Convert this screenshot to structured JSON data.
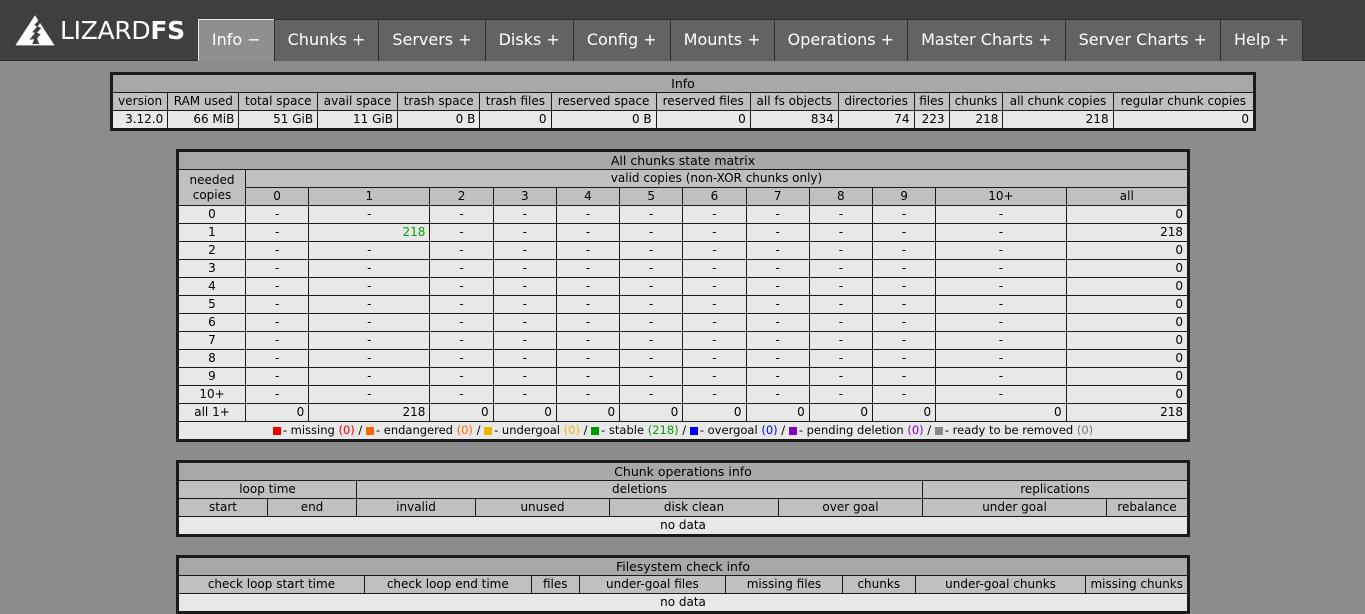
{
  "brand": {
    "name_light": "LIZARD",
    "name_bold": "FS",
    "logo_icon": "lizard-triangle-logo"
  },
  "nav": {
    "tabs": [
      {
        "label": "Info −",
        "active": true
      },
      {
        "label": "Chunks +",
        "active": false
      },
      {
        "label": "Servers +",
        "active": false
      },
      {
        "label": "Disks +",
        "active": false
      },
      {
        "label": "Config +",
        "active": false
      },
      {
        "label": "Mounts +",
        "active": false
      },
      {
        "label": "Operations +",
        "active": false
      },
      {
        "label": "Master Charts +",
        "active": false
      },
      {
        "label": "Server Charts +",
        "active": false
      },
      {
        "label": "Help +",
        "active": false
      }
    ]
  },
  "info_table": {
    "title": "Info",
    "headers": [
      "version",
      "RAM used",
      "total space",
      "avail space",
      "trash space",
      "trash files",
      "reserved space",
      "reserved files",
      "all fs objects",
      "directories",
      "files",
      "chunks",
      "all chunk copies",
      "regular chunk copies"
    ],
    "row": [
      "3.12.0",
      "66 MiB",
      "51 GiB",
      "11 GiB",
      "0 B",
      "0",
      "0 B",
      "0",
      "834",
      "74",
      "223",
      "218",
      "218",
      "0"
    ]
  },
  "matrix": {
    "title": "All chunks state matrix",
    "row_header_line1": "needed",
    "row_header_line2": "copies",
    "col_group_title": "valid copies (non-XOR chunks only)",
    "columns": [
      "0",
      "1",
      "2",
      "3",
      "4",
      "5",
      "6",
      "7",
      "8",
      "9",
      "10+",
      "all"
    ],
    "rows": [
      {
        "label": "0",
        "cells": [
          "-",
          "-",
          "-",
          "-",
          "-",
          "-",
          "-",
          "-",
          "-",
          "-",
          "-"
        ],
        "all": "0"
      },
      {
        "label": "1",
        "cells": [
          "-",
          "218",
          "-",
          "-",
          "-",
          "-",
          "-",
          "-",
          "-",
          "-",
          "-"
        ],
        "all": "218",
        "highlight_index": 1,
        "highlight_color": "green"
      },
      {
        "label": "2",
        "cells": [
          "-",
          "-",
          "-",
          "-",
          "-",
          "-",
          "-",
          "-",
          "-",
          "-",
          "-"
        ],
        "all": "0"
      },
      {
        "label": "3",
        "cells": [
          "-",
          "-",
          "-",
          "-",
          "-",
          "-",
          "-",
          "-",
          "-",
          "-",
          "-"
        ],
        "all": "0"
      },
      {
        "label": "4",
        "cells": [
          "-",
          "-",
          "-",
          "-",
          "-",
          "-",
          "-",
          "-",
          "-",
          "-",
          "-"
        ],
        "all": "0"
      },
      {
        "label": "5",
        "cells": [
          "-",
          "-",
          "-",
          "-",
          "-",
          "-",
          "-",
          "-",
          "-",
          "-",
          "-"
        ],
        "all": "0"
      },
      {
        "label": "6",
        "cells": [
          "-",
          "-",
          "-",
          "-",
          "-",
          "-",
          "-",
          "-",
          "-",
          "-",
          "-"
        ],
        "all": "0"
      },
      {
        "label": "7",
        "cells": [
          "-",
          "-",
          "-",
          "-",
          "-",
          "-",
          "-",
          "-",
          "-",
          "-",
          "-"
        ],
        "all": "0"
      },
      {
        "label": "8",
        "cells": [
          "-",
          "-",
          "-",
          "-",
          "-",
          "-",
          "-",
          "-",
          "-",
          "-",
          "-"
        ],
        "all": "0"
      },
      {
        "label": "9",
        "cells": [
          "-",
          "-",
          "-",
          "-",
          "-",
          "-",
          "-",
          "-",
          "-",
          "-",
          "-"
        ],
        "all": "0"
      },
      {
        "label": "10+",
        "cells": [
          "-",
          "-",
          "-",
          "-",
          "-",
          "-",
          "-",
          "-",
          "-",
          "-",
          "-"
        ],
        "all": "0"
      },
      {
        "label": "all 1+",
        "cells": [
          "0",
          "218",
          "0",
          "0",
          "0",
          "0",
          "0",
          "0",
          "0",
          "0",
          "0"
        ],
        "all": "218"
      }
    ],
    "legend": [
      {
        "color": "#ee0000",
        "label": "missing",
        "count": "0",
        "count_class": "num-red"
      },
      {
        "color": "#ff6600",
        "label": "endangered",
        "count": "0",
        "count_class": "num-orange-d"
      },
      {
        "color": "#f0b400",
        "label": "undergoal",
        "count": "0",
        "count_class": "num-orange-l"
      },
      {
        "color": "#009900",
        "label": "stable",
        "count": "218",
        "count_class": "num-green"
      },
      {
        "color": "#0000ee",
        "label": "overgoal",
        "count": "0",
        "count_class": "num-blue"
      },
      {
        "color": "#8800bb",
        "label": "pending deletion",
        "count": "0",
        "count_class": "num-purple"
      },
      {
        "color": "#888888",
        "label": "ready to be removed",
        "count": "0",
        "count_class": "num-gray"
      }
    ]
  },
  "chunk_operations": {
    "title": "Chunk operations info",
    "group_headers": [
      {
        "label": "loop time",
        "span": 2
      },
      {
        "label": "deletions",
        "span": 4
      },
      {
        "label": "replications",
        "span": 2
      }
    ],
    "sub_headers": [
      "start",
      "end",
      "invalid",
      "unused",
      "disk clean",
      "over goal",
      "under goal",
      "rebalance"
    ],
    "empty_message": "no data"
  },
  "filesystem_check": {
    "title": "Filesystem check info",
    "headers": [
      "check loop start time",
      "check loop end time",
      "files",
      "under-goal files",
      "missing files",
      "chunks",
      "under-goal chunks",
      "missing chunks"
    ],
    "empty_message": "no data"
  }
}
